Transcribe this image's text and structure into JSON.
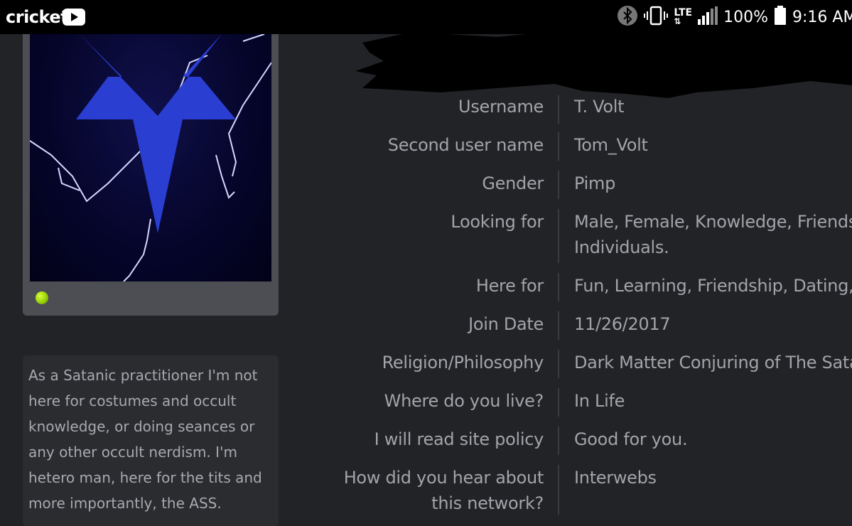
{
  "status_bar": {
    "carrier": "cricket",
    "icons": [
      "youtube-icon",
      "bluetooth-icon",
      "vibrate-icon",
      "lte-icon",
      "signal-icon",
      "battery-icon"
    ],
    "network": "LTE",
    "battery": "100%",
    "time": "9:16 AM"
  },
  "profile": {
    "online_color": "#9ad10a",
    "bio": "As a Satanic practitioner I'm not here for costumes and occult knowledge, or doing seances or any other occult nerdism. I'm hetero man, here for the tits and more importantly, the ASS."
  },
  "info": [
    {
      "label": "Username",
      "value": "T. Volt"
    },
    {
      "label": "Second user name",
      "value": "Tom_Volt"
    },
    {
      "label": "Gender",
      "value": "Pimp"
    },
    {
      "label": "Looking for",
      "value": "Male, Female, Knowledge, Friends, Individuals."
    },
    {
      "label": "Here for",
      "value": "Fun, Learning, Friendship, Dating, W"
    },
    {
      "label": "Join Date",
      "value": "11/26/2017"
    },
    {
      "label": "Religion/Philosophy",
      "value": "Dark Matter Conjuring of The Sata"
    },
    {
      "label": "Where do you live?",
      "value": "In Life"
    },
    {
      "label": "I will read site policy",
      "value": "Good for you."
    },
    {
      "label": "How did you hear about this network?",
      "value": "Interwebs"
    }
  ],
  "colors": {
    "background": "#222326",
    "text": "#a2a4a9",
    "card": "#4c4e53"
  }
}
